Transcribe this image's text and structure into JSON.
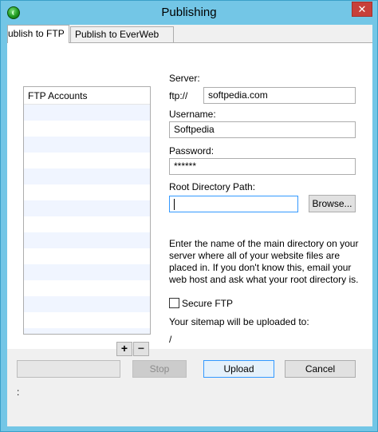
{
  "window": {
    "title": "Publishing",
    "close_glyph": "✕"
  },
  "tabs": [
    {
      "label": "ublish to FTP",
      "active": true
    },
    {
      "label": "Publish to EverWeb",
      "active": false
    }
  ],
  "accounts": {
    "header": "FTP Accounts",
    "add_label": "+",
    "remove_label": "−"
  },
  "form": {
    "server_label": "Server:",
    "server_prefix": "ftp://",
    "server_value": "softpedia.com",
    "username_label": "Username:",
    "username_value": "Softpedia",
    "password_label": "Password:",
    "password_value": "******",
    "root_label": "Root Directory Path:",
    "root_value": "",
    "browse_label": "Browse...",
    "help_text": "Enter the name of the main directory on your server where all of your website files are placed in. If you don't know this, email your web host and ask what your root directory is.",
    "secure_label": "Secure FTP",
    "sitemap_label": "Your sitemap will be uploaded to:",
    "sitemap_path": "/"
  },
  "footer": {
    "stop_label": "Stop",
    "upload_label": "Upload",
    "cancel_label": "Cancel",
    "status_text": ":"
  },
  "colors": {
    "window_frame": "#73c6e6",
    "close_button": "#c7403a",
    "focus": "#3399ff"
  }
}
